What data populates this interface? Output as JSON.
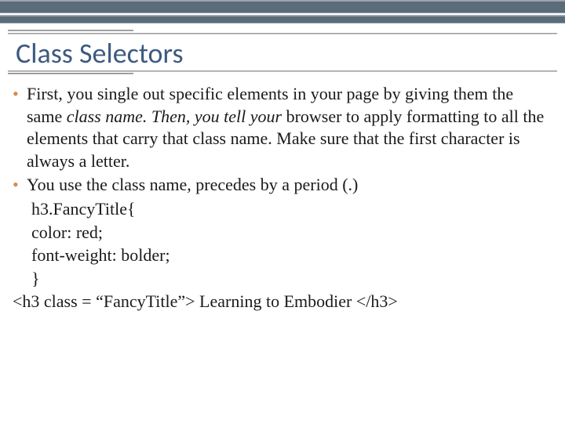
{
  "title": "Class Selectors",
  "bullets": [
    {
      "pre": "First, you single out specific elements in your page by giving them the same ",
      "italic": "class name. Then, you tell your",
      "post": " browser to apply formatting to all the elements that carry that class name. Make sure that the first character is always a letter."
    },
    {
      "pre": "You use the class name, precedes by a period (.)",
      "italic": "",
      "post": ""
    }
  ],
  "code": {
    "l1": "h3.FancyTitle{",
    "l2": "color: red;",
    "l3": "font-weight: bolder;",
    "l4": "}"
  },
  "htmlLine": "<h3 class = “FancyTitle”> Learning to Embodier </h3>"
}
